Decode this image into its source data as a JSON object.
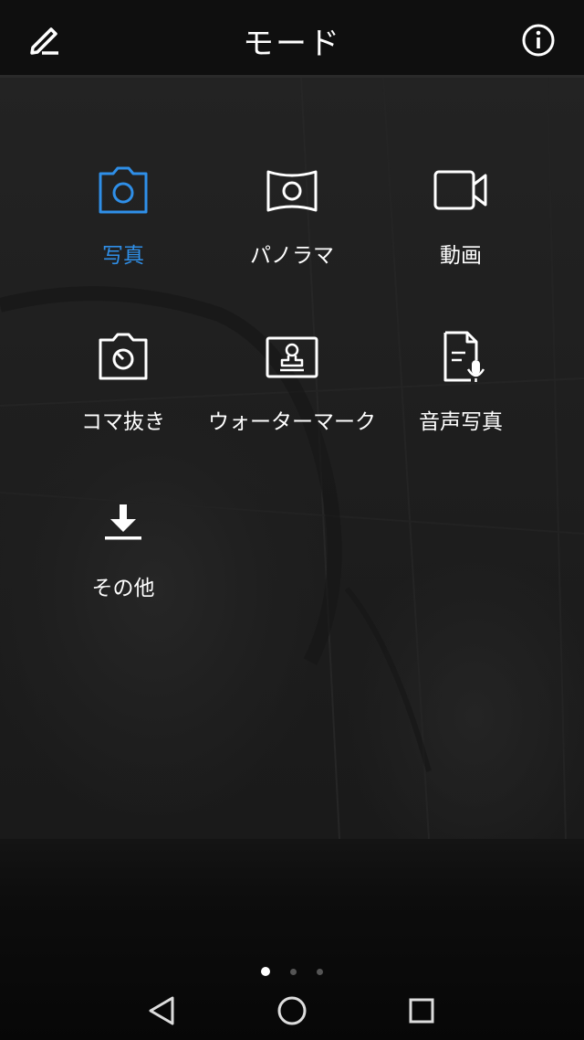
{
  "header": {
    "title": "モード",
    "edit_icon": "pencil-icon",
    "info_icon": "info-icon"
  },
  "modes": [
    {
      "label": "写真",
      "icon": "camera-icon",
      "active": true
    },
    {
      "label": "パノラマ",
      "icon": "panorama-icon",
      "active": false
    },
    {
      "label": "動画",
      "icon": "video-camera-icon",
      "active": false
    },
    {
      "label": "コマ抜き",
      "icon": "timelapse-icon",
      "active": false
    },
    {
      "label": "ウォーターマーク",
      "icon": "watermark-stamp-icon",
      "active": false
    },
    {
      "label": "音声写真",
      "icon": "audio-note-icon",
      "active": false
    },
    {
      "label": "その他",
      "icon": "download-icon",
      "active": false
    }
  ],
  "pager": {
    "pages": 3,
    "current": 1
  },
  "navigation": {
    "back_icon": "back-triangle-icon",
    "home_icon": "home-circle-icon",
    "recents_icon": "recents-square-icon"
  },
  "colors": {
    "accent": "#2f8fe8",
    "background": "#191919",
    "bar": "#0f0f0f"
  }
}
